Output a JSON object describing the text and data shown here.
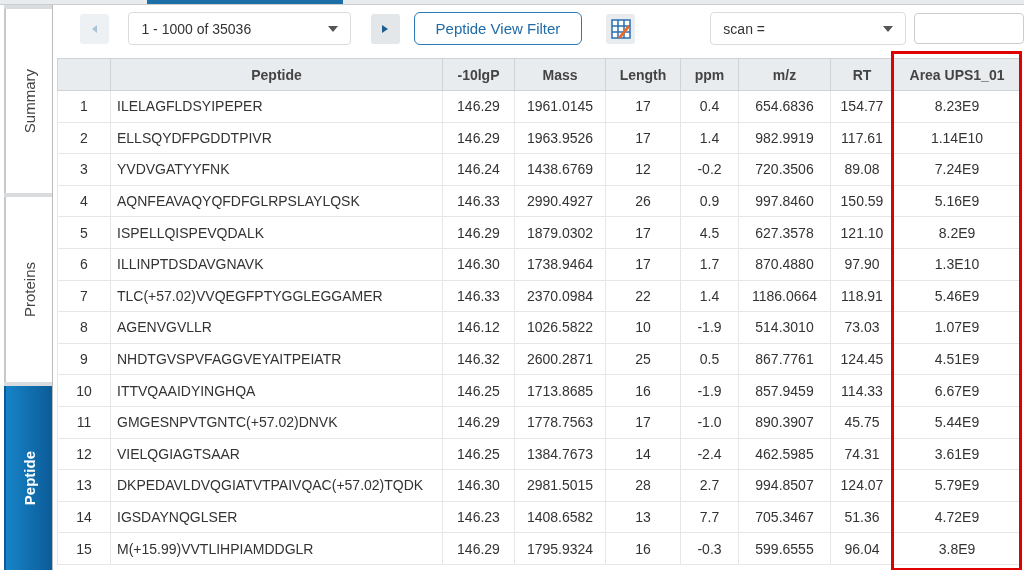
{
  "side_tabs": [
    {
      "label": "Summary",
      "selected": false
    },
    {
      "label": "Proteins",
      "selected": false
    },
    {
      "label": "Peptide",
      "selected": true
    }
  ],
  "toolbar": {
    "range": "1 - 1000 of 35036",
    "filter_button": "Peptide View Filter",
    "search_field": "scan ="
  },
  "table": {
    "columns": [
      {
        "highlighted": false
      },
      {
        "label": "Peptide",
        "highlighted": false
      },
      {
        "label": "-10lgP",
        "highlighted": false
      },
      {
        "label": "Mass",
        "highlighted": false
      },
      {
        "label": "Length",
        "highlighted": false
      },
      {
        "label": "ppm",
        "highlighted": false
      },
      {
        "label": "m/z",
        "highlighted": false
      },
      {
        "label": "RT",
        "highlighted": false
      },
      {
        "label": "Area UPS1_01",
        "highlighted": true
      }
    ],
    "rows": [
      [
        "1",
        "ILELAGFLDSYIPEPER",
        "146.29",
        "1961.0145",
        "17",
        "0.4",
        "654.6836",
        "154.77",
        "8.23E9"
      ],
      [
        "2",
        "ELLSQYDFPGDDTPIVR",
        "146.29",
        "1963.9526",
        "17",
        "1.4",
        "982.9919",
        "117.61",
        "1.14E10"
      ],
      [
        "3",
        "YVDVGATYYFNK",
        "146.24",
        "1438.6769",
        "12",
        "-0.2",
        "720.3506",
        "89.08",
        "7.24E9"
      ],
      [
        "4",
        "AQNFEAVAQYQFDFGLRPSLAYLQSK",
        "146.33",
        "2990.4927",
        "26",
        "0.9",
        "997.8460",
        "150.59",
        "5.16E9"
      ],
      [
        "5",
        "ISPELLQISPEVQDALK",
        "146.29",
        "1879.0302",
        "17",
        "4.5",
        "627.3578",
        "121.10",
        "8.2E9"
      ],
      [
        "6",
        "ILLINPTDSDAVGNAVK",
        "146.30",
        "1738.9464",
        "17",
        "1.7",
        "870.4880",
        "97.90",
        "1.3E10"
      ],
      [
        "7",
        "TLC(+57.02)VVQEGFPTYGGLEGGAMER",
        "146.33",
        "2370.0984",
        "22",
        "1.4",
        "1186.0664",
        "118.91",
        "5.46E9"
      ],
      [
        "8",
        "AGENVGVLLR",
        "146.12",
        "1026.5822",
        "10",
        "-1.9",
        "514.3010",
        "73.03",
        "1.07E9"
      ],
      [
        "9",
        "NHDTGVSPVFAGGVEYAITPEIATR",
        "146.32",
        "2600.2871",
        "25",
        "0.5",
        "867.7761",
        "124.45",
        "4.51E9"
      ],
      [
        "10",
        "ITTVQAAIDYINGHQA",
        "146.25",
        "1713.8685",
        "16",
        "-1.9",
        "857.9459",
        "114.33",
        "6.67E9"
      ],
      [
        "11",
        "GMGESNPVTGNTC(+57.02)DNVK",
        "146.29",
        "1778.7563",
        "17",
        "-1.0",
        "890.3907",
        "45.75",
        "5.44E9"
      ],
      [
        "12",
        "VIELQGIAGTSAAR",
        "146.25",
        "1384.7673",
        "14",
        "-2.4",
        "462.5985",
        "74.31",
        "3.61E9"
      ],
      [
        "13",
        "DKPEDAVLDVQGIATVTPAIVQAC(+57.02)TQDK",
        "146.30",
        "2981.5015",
        "28",
        "2.7",
        "994.8507",
        "124.07",
        "5.79E9"
      ],
      [
        "14",
        "IGSDAYNQGLSER",
        "146.23",
        "1408.6582",
        "13",
        "7.7",
        "705.3467",
        "51.36",
        "4.72E9"
      ],
      [
        "15",
        "M(+15.99)VVTLIHPIAMDDGLR",
        "146.29",
        "1795.9324",
        "16",
        "-0.3",
        "599.6555",
        "96.04",
        "3.8E9"
      ]
    ]
  }
}
